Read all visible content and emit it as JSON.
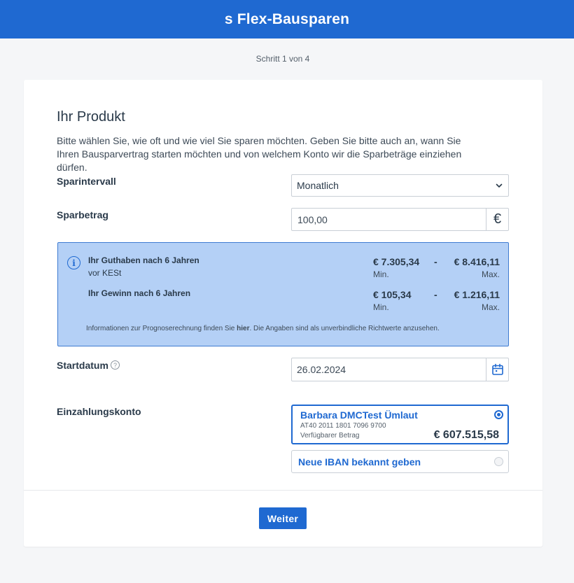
{
  "header": {
    "title": "s Flex-Bausparen"
  },
  "progress": {
    "step_text": "Schritt 1 von 4"
  },
  "product": {
    "title": "Ihr Produkt",
    "intro": "Bitte wählen Sie, wie oft und wie viel Sie sparen möchten. Geben Sie bitte auch an, wann Sie Ihren Bausparvertrag starten möchten und von welchem Konto wir die Sparbeträge einziehen dürfen."
  },
  "sparintervall": {
    "label": "Sparintervall",
    "value": "Monatlich"
  },
  "sparbetrag": {
    "label": "Sparbetrag",
    "value": "100,00",
    "currency_symbol": "€"
  },
  "forecast": {
    "guthaben_label": "Ihr Guthaben nach 6 Jahren",
    "guthaben_sub": "vor KESt",
    "guthaben_min": "€ 7.305,34",
    "guthaben_max": "€ 8.416,11",
    "gewinn_label": "Ihr Gewinn nach 6 Jahren",
    "gewinn_min": "€ 105,34",
    "gewinn_max": "€ 1.216,11",
    "dash": "-",
    "min_label": "Min.",
    "max_label": "Max.",
    "note_before": "Informationen zur Prognoserechnung finden Sie ",
    "note_link": "hier",
    "note_after": ". Die Angaben sind als unverbindliche Richtwerte anzusehen."
  },
  "startdatum": {
    "label": "Startdatum",
    "value": "26.02.2024"
  },
  "einzahlungskonto": {
    "label": "Einzahlungskonto",
    "selected_account": {
      "name": "Barbara DMCTest Ümlaut",
      "iban": "AT40 2011 1801 7096 9700",
      "available_label": "Verfügbarer Betrag",
      "balance": "€ 607.515,58"
    },
    "new_iban_label": "Neue IBAN bekannt geben"
  },
  "actions": {
    "next_label": "Weiter"
  },
  "colors": {
    "brand": "#1f69d1",
    "info_bg": "#b4d0f6"
  }
}
